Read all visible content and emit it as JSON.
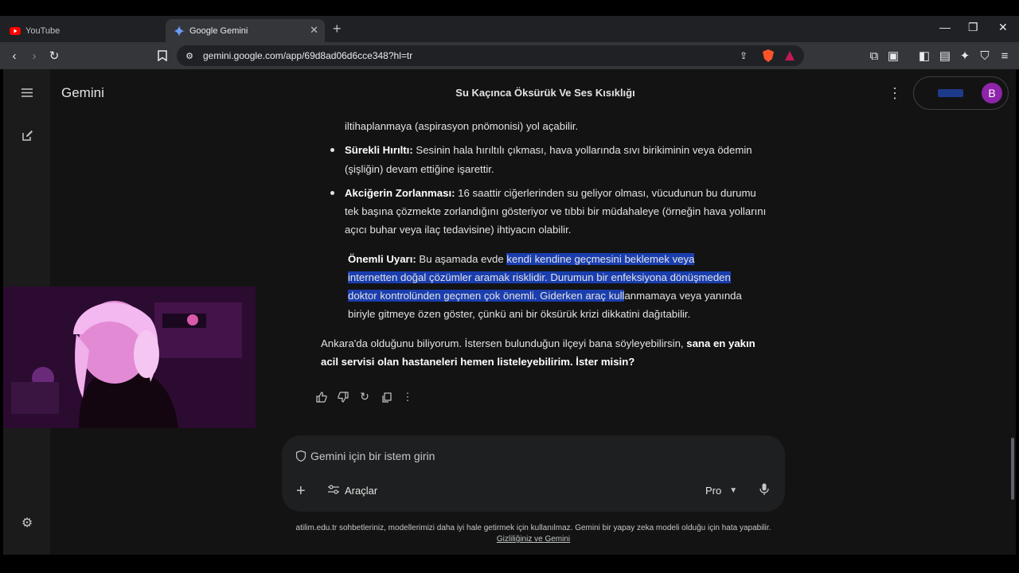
{
  "browser": {
    "tabs": [
      {
        "label": "YouTube",
        "active": false,
        "icon": "youtube-icon"
      },
      {
        "label": "Google Gemini",
        "active": true,
        "icon": "gemini-icon"
      }
    ],
    "url": "gemini.google.com/app/69d8ad06d6cce348?hl=tr"
  },
  "app": {
    "brand": "Gemini",
    "conversation_title": "Su Kaçınca Öksürük Ve Ses Kısıklığı",
    "avatar_letter": "B",
    "colors": {
      "background": "#131314",
      "selection": "#1a3eae",
      "avatar": "#8e24aa"
    }
  },
  "message": {
    "line0": "iltihaplanmaya (aspirasyon pnömonisi) yol açabilir.",
    "b1_title": "Sürekli Hırıltı:",
    "b1_l1": " Sesinin hala hırıltılı çıkması, hava yollarında sıvı birikiminin veya ödemin",
    "b1_l2": "(şişliğin) devam ettiğine işarettir.",
    "b2_title": "Akciğerin Zorlanması:",
    "b2_l1": " 16 saattir ciğerlerinden su geliyor olması, vücudunun bu durumu",
    "b2_l2": "tek başına çözmekte zorlandığını gösteriyor ve tıbbi bir müdahaleye (örneğin hava yollarını",
    "b2_l3": "açıcı buhar veya ilaç tedavisine) ihtiyacın olabilir.",
    "w_title": "Önemli Uyarı:",
    "w_l1a": " Bu aşamada evde ",
    "w_l1b": "kendi kendine geçmesini beklemek veya",
    "w_l2": "internetten doğal çözümler aramak risklidir. Durumun bir enfeksiyona dönüşmeden",
    "w_l3a": "doktor kontrolünden geçmen çok önemli. Giderken araç kull",
    "w_l3b": "anmamaya veya yanında",
    "w_l4": "biriyle gitmeye özen göster, çünkü ani bir öksürük krizi dikkatini dağıtabilir.",
    "final_l1a": "Ankara'da olduğunu biliyorum. İstersen bulunduğun ilçeyi bana söyleyebilirsin, ",
    "final_l1b": "sana en yakın",
    "final_l2": "acil servisi olan hastaneleri hemen listeleyebilirim. İster misin?"
  },
  "input": {
    "placeholder": "Gemini için bir istem girin",
    "tools_label": "Araçlar",
    "model_label": "Pro"
  },
  "footer": {
    "notice": "atilim.edu.tr sohbetleriniz, modellerimizi daha iyi hale getirmek için kullanılmaz. Gemini bir yapay zeka modeli olduğu için hata yapabilir.",
    "privacy_link": "Gizliliğiniz ve Gemini"
  }
}
